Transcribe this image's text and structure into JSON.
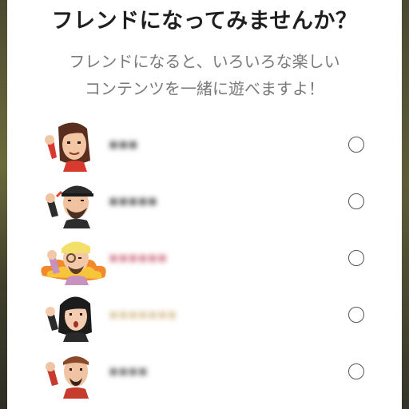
{
  "dialog": {
    "title": "フレンドになってみませんか？",
    "subtitle_line1": "フレンドになると、いろいろな楽しい",
    "subtitle_line2": "コンテンツを一緒に遊べますよ！"
  },
  "friends": [
    {
      "name": "▪▪▪",
      "name_color": "#6b6b6b",
      "selected": false
    },
    {
      "name": "▪▪▪▪▪",
      "name_color": "#6b6b6b",
      "selected": false
    },
    {
      "name": "▪▪▪▪▪▪",
      "name_color": "#d98b9a",
      "selected": false
    },
    {
      "name": "▪▪▪▪▪▪▪",
      "name_color": "#e8d7b8",
      "selected": false
    },
    {
      "name": "▪▪▪▪",
      "name_color": "#7a7a7a",
      "selected": false
    }
  ]
}
